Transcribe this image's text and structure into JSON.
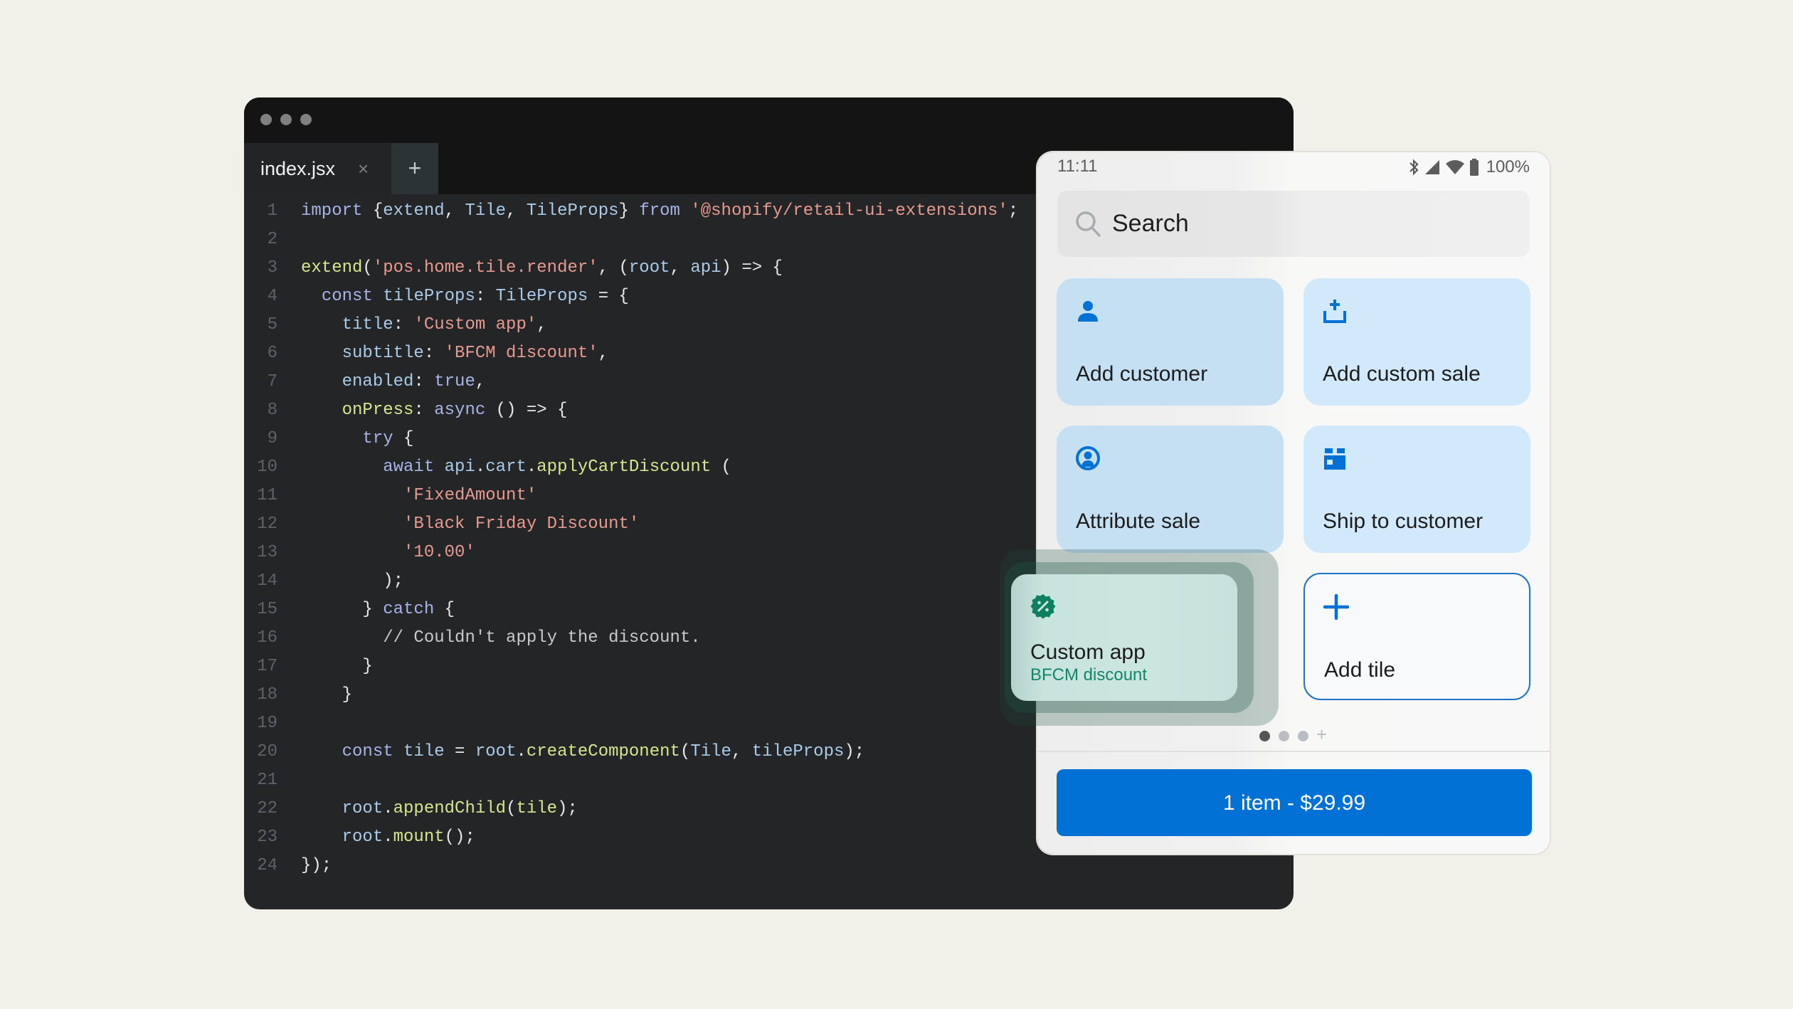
{
  "editor": {
    "tab": {
      "filename": "index.jsx",
      "close_glyph": "×",
      "add_glyph": "+"
    },
    "code_lines": [
      [
        [
          "kw",
          "import "
        ],
        [
          "pun",
          "{"
        ],
        [
          "id",
          "extend"
        ],
        [
          "pun",
          ", "
        ],
        [
          "id",
          "Tile"
        ],
        [
          "pun",
          ", "
        ],
        [
          "id",
          "TileProps"
        ],
        [
          "pun",
          "} "
        ],
        [
          "kw",
          "from "
        ],
        [
          "str",
          "'@shopify/retail-ui-extensions'"
        ],
        [
          "pun",
          ";"
        ]
      ],
      [],
      [
        [
          "fn",
          "extend"
        ],
        [
          "pun",
          "("
        ],
        [
          "str",
          "'pos.home.tile.render'"
        ],
        [
          "pun",
          ", ("
        ],
        [
          "id",
          "root"
        ],
        [
          "pun",
          ", "
        ],
        [
          "id",
          "api"
        ],
        [
          "pun",
          ") => {"
        ]
      ],
      [
        [
          "pun",
          "  "
        ],
        [
          "kw",
          "const "
        ],
        [
          "id",
          "tileProps"
        ],
        [
          "pun",
          ": "
        ],
        [
          "id",
          "TileProps"
        ],
        [
          "pun",
          " = {"
        ]
      ],
      [
        [
          "pun",
          "    "
        ],
        [
          "id",
          "title"
        ],
        [
          "pun",
          ": "
        ],
        [
          "str",
          "'Custom app'"
        ],
        [
          "pun",
          ","
        ]
      ],
      [
        [
          "pun",
          "    "
        ],
        [
          "id",
          "subtitle"
        ],
        [
          "pun",
          ": "
        ],
        [
          "str",
          "'BFCM discount'"
        ],
        [
          "pun",
          ","
        ]
      ],
      [
        [
          "pun",
          "    "
        ],
        [
          "id",
          "enabled"
        ],
        [
          "pun",
          ": "
        ],
        [
          "kw",
          "true"
        ],
        [
          "pun",
          ","
        ]
      ],
      [
        [
          "pun",
          "    "
        ],
        [
          "fn",
          "onPress"
        ],
        [
          "pun",
          ": "
        ],
        [
          "kw",
          "async "
        ],
        [
          "pun",
          "() => {"
        ]
      ],
      [
        [
          "pun",
          "      "
        ],
        [
          "kw",
          "try "
        ],
        [
          "pun",
          "{"
        ]
      ],
      [
        [
          "pun",
          "        "
        ],
        [
          "kw",
          "await "
        ],
        [
          "id",
          "api"
        ],
        [
          "pun",
          "."
        ],
        [
          "id",
          "cart"
        ],
        [
          "pun",
          "."
        ],
        [
          "fn",
          "applyCartDiscount"
        ],
        [
          "pun",
          " ("
        ]
      ],
      [
        [
          "pun",
          "          "
        ],
        [
          "str",
          "'FixedAmount'"
        ]
      ],
      [
        [
          "pun",
          "          "
        ],
        [
          "str",
          "'Black Friday Discount'"
        ]
      ],
      [
        [
          "pun",
          "          "
        ],
        [
          "str",
          "'10.00'"
        ]
      ],
      [
        [
          "pun",
          "        );"
        ]
      ],
      [
        [
          "pun",
          "      } "
        ],
        [
          "kw",
          "catch "
        ],
        [
          "pun",
          "{"
        ]
      ],
      [
        [
          "pun",
          "        "
        ],
        [
          "cm",
          "// Couldn't apply the discount."
        ]
      ],
      [
        [
          "pun",
          "      }"
        ]
      ],
      [
        [
          "pun",
          "    }"
        ]
      ],
      [],
      [
        [
          "pun",
          "    "
        ],
        [
          "kw",
          "const "
        ],
        [
          "id",
          "tile"
        ],
        [
          "pun",
          " = "
        ],
        [
          "id",
          "root"
        ],
        [
          "pun",
          "."
        ],
        [
          "fn",
          "createComponent"
        ],
        [
          "pun",
          "("
        ],
        [
          "id",
          "Tile"
        ],
        [
          "pun",
          ", "
        ],
        [
          "id",
          "tileProps"
        ],
        [
          "pun",
          ");"
        ]
      ],
      [],
      [
        [
          "pun",
          "    "
        ],
        [
          "id",
          "root"
        ],
        [
          "pun",
          "."
        ],
        [
          "fn",
          "appendChild"
        ],
        [
          "pun",
          "("
        ],
        [
          "fn",
          "tile"
        ],
        [
          "pun",
          ");"
        ]
      ],
      [
        [
          "pun",
          "    "
        ],
        [
          "id",
          "root"
        ],
        [
          "pun",
          "."
        ],
        [
          "fn",
          "mount"
        ],
        [
          "pun",
          "();"
        ]
      ],
      [
        [
          "pun",
          "});"
        ]
      ]
    ]
  },
  "phone": {
    "status": {
      "time": "11:11",
      "battery": "100%",
      "icons": [
        "bluetooth-icon",
        "signal-icon",
        "wifi-icon",
        "battery-icon"
      ]
    },
    "search": {
      "placeholder": "Search"
    },
    "tiles": [
      {
        "title": "Add customer",
        "icon": "person-icon"
      },
      {
        "title": "Add custom sale",
        "icon": "add-to-basket-icon"
      },
      {
        "title": "Attribute sale",
        "icon": "person-circle-icon"
      },
      {
        "title": "Ship to customer",
        "icon": "package-icon"
      },
      {
        "title": "Add tile",
        "icon": "plus-icon"
      }
    ],
    "custom_tile": {
      "title": "Custom app",
      "subtitle": "BFCM discount",
      "icon": "discount-badge-icon"
    },
    "pager": {
      "pages": 3,
      "active": 1,
      "add_glyph": "+"
    },
    "checkout_label": "1 item - $29.99"
  },
  "colors": {
    "accent": "#0171d6",
    "tile_blue": "#c6e0f3",
    "discount_green": "#13866a"
  }
}
